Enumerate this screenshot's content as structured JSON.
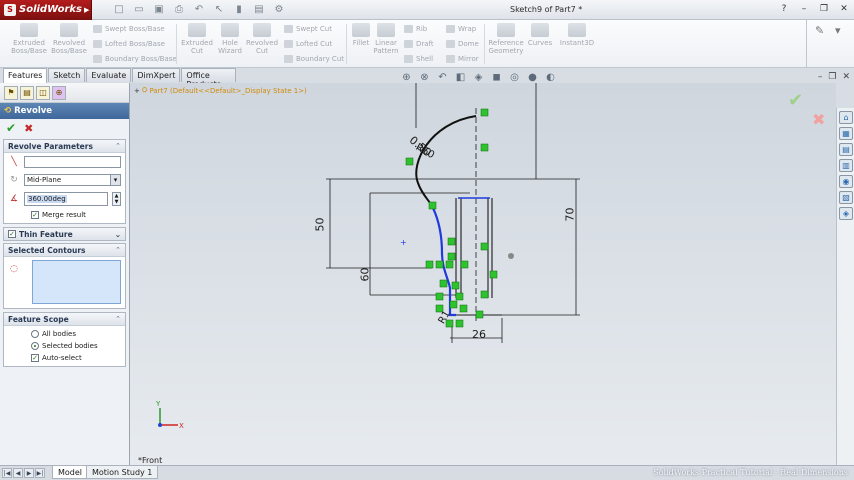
{
  "app": {
    "name": "SolidWorks",
    "doc_title": "Sketch9 of Part7 *"
  },
  "ribbon": {
    "extruded_boss": "Extruded Boss/Base",
    "revolved_boss": "Revolved Boss/Base",
    "swept_boss": "Swept Boss/Base",
    "lofted_boss": "Lofted Boss/Base",
    "boundary_boss": "Boundary Boss/Base",
    "extruded_cut": "Extruded Cut",
    "hole_wizard": "Hole Wizard",
    "revolved_cut": "Revolved Cut",
    "swept_cut": "Swept Cut",
    "lofted_cut": "Lofted Cut",
    "boundary_cut": "Boundary Cut",
    "fillet": "Fillet",
    "linear_pattern": "Linear Pattern",
    "rib": "Rib",
    "draft": "Draft",
    "shell": "Shell",
    "wrap": "Wrap",
    "dome": "Dome",
    "mirror": "Mirror",
    "reference_geometry": "Reference Geometry",
    "curves": "Curves",
    "instant3d": "Instant3D"
  },
  "tabs": [
    {
      "label": "Features",
      "active": true
    },
    {
      "label": "Sketch",
      "active": false
    },
    {
      "label": "Evaluate",
      "active": false
    },
    {
      "label": "DimXpert",
      "active": false
    },
    {
      "label": "Office Products",
      "active": false
    }
  ],
  "tree": {
    "root_label": "Part7  (Default<<Default>_Display State 1>)"
  },
  "property_manager": {
    "title": "Revolve",
    "revolve_params": {
      "header": "Revolve Parameters",
      "axis_value": "",
      "type_value": "Mid-Plane",
      "angle_value": "360.00deg",
      "merge_result_label": "Merge result",
      "merge_result_checked": true
    },
    "thin_feature": {
      "header": "Thin Feature",
      "checked": true
    },
    "selected_contours": {
      "header": "Selected Contours"
    },
    "feature_scope": {
      "header": "Feature Scope",
      "all_bodies": "All bodies",
      "selected_bodies": "Selected bodies",
      "auto_select": "Auto-select",
      "selected_option": "selected_bodies",
      "auto_select_checked": true
    }
  },
  "sketch": {
    "dim_50": "50",
    "dim_60": "60",
    "dim_70": "70",
    "dim_26": "26",
    "dim_r1": "R1",
    "dim_r60": "R60",
    "dim_0_50": "0.50"
  },
  "view": {
    "orientation_label": "*Front"
  },
  "bottom_tabs": [
    {
      "label": "Model",
      "active": true
    },
    {
      "label": "Motion Study 1",
      "active": false
    }
  ],
  "watermark": "SolidWorks Practical Tutorial - Real Dimensions",
  "colors": {
    "sketch_black": "#111111",
    "sketch_selected": "#1f3be0",
    "relation_green": "#2fc22f",
    "brand_red": "#b41c1c"
  }
}
